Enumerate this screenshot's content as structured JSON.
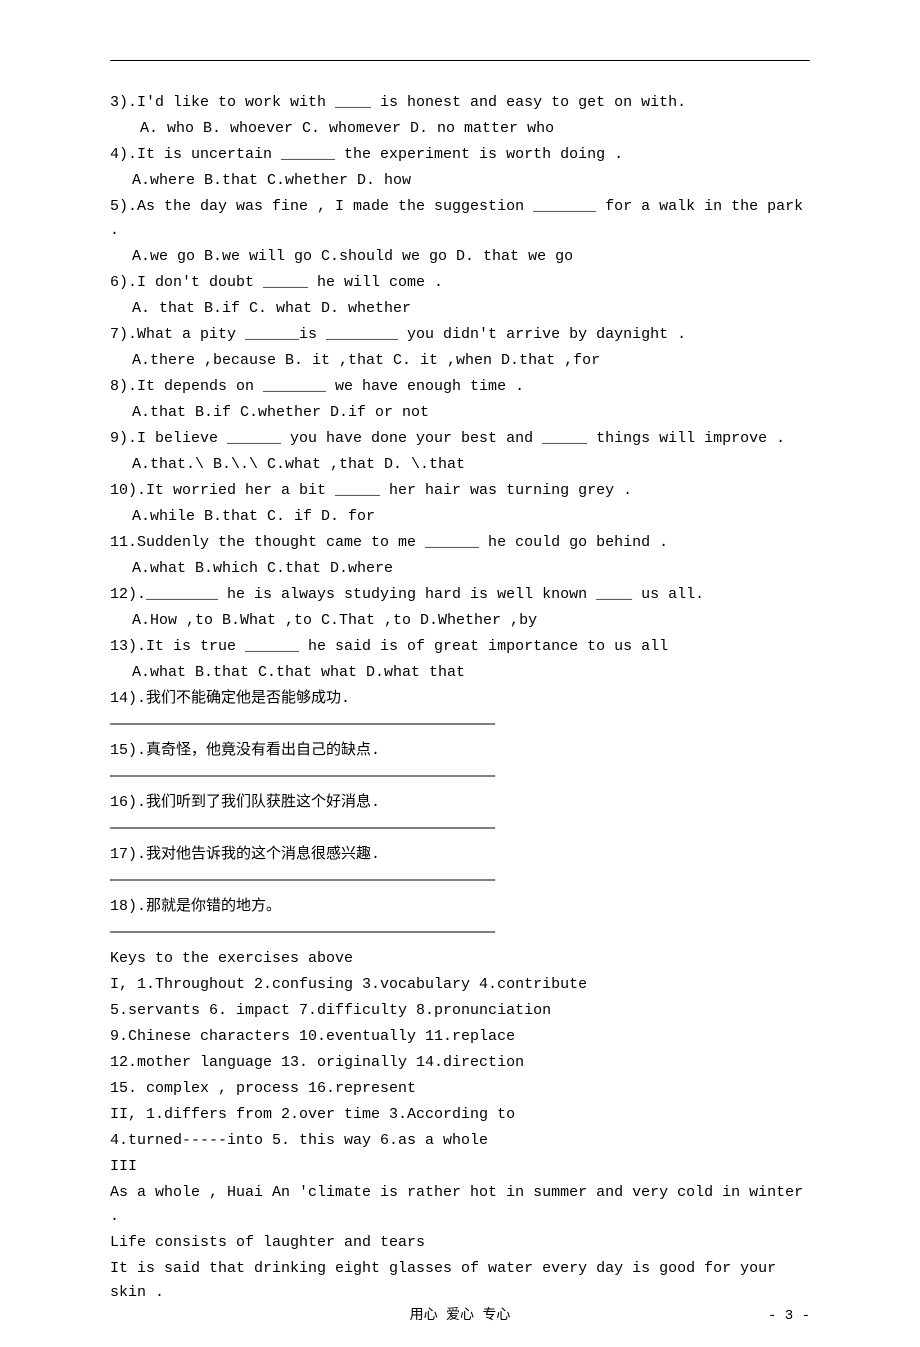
{
  "questions": {
    "q3": {
      "text": "3).I'd like to work with ____ is honest and easy to get on with.",
      "options": "A. who   B. whoever  C. whomever    D. no matter who"
    },
    "q4": {
      "text": "4).It is uncertain ______ the experiment is worth doing .",
      "options": "A.where  B.that  C.whether   D. how"
    },
    "q5": {
      "text": "5).As the day was fine , I made the suggestion _______ for  a walk in the park .",
      "options": "A.we go B.we will go  C.should we go  D. that we go"
    },
    "q6": {
      "text": "6).I don't doubt _____ he will come .",
      "options": "A. that  B.if  C. what  D. whether"
    },
    "q7": {
      "text": "7).What a pity ______is ________ you didn't arrive by daynight .",
      "options": "A.there ,because  B. it ,that  C. it ,when  D.that ,for"
    },
    "q8": {
      "text": "8).It depends on _______ we have enough time .",
      "options": "A.that  B.if   C.whether  D.if or not"
    },
    "q9": {
      "text": "9).I believe ______ you have done your best and _____ things will improve .",
      "options": "A.that.\\  B.\\.\\  C.what ,that   D. \\.that"
    },
    "q10": {
      "text": "10).It worried her a bit _____ her hair was turning grey .",
      "options": "A.while  B.that  C. if  D. for"
    },
    "q11": {
      "text": "11.Suddenly the thought came to me ______ he could go behind .",
      "options": "A.what  B.which  C.that  D.where"
    },
    "q12": {
      "text": "12).________ he is always studying hard is well known ____ us all.",
      "options": "A.How ,to  B.What ,to  C.That ,to  D.Whether ,by"
    },
    "q13": {
      "text": "13).It is true ______ he said is of great importance to us all",
      "options": "A.what  B.that  C.that what  D.what that"
    },
    "q14": "14).我们不能确定他是否能够成功.",
    "q15": "15).真奇怪，他竟没有看出自己的缺点.",
    "q16": "16).我们听到了我们队获胜这个好消息.",
    "q17": "17).我对他告诉我的这个消息很感兴趣.",
    "q18": "18).那就是你错的地方。"
  },
  "rule": "————————————————————————————————————————————————",
  "answers": {
    "header": "Keys to the exercises above",
    "I_line1": "I,   1.Throughout  2.confusing  3.vocabulary  4.contribute",
    "I_line2": "5.servants  6. impact  7.difficulty  8.pronunciation",
    "I_line3": "9.Chinese characters 10.eventually  11.replace",
    "I_line4": "12.mother language   13. originally 14.direction",
    "I_line5": "15. complex  , process  16.represent",
    "II_line1": "II,   1.differs from   2.over time  3.According to",
    "II_line2": " 4.turned-----into  5. this way  6.as a whole",
    "III_header": "III",
    "III_line1": "As a whole , Huai An 'climate is rather hot in summer and very cold in winter   .",
    "III_line2": "Life consists of laughter and tears",
    "III_line3": "It is said that drinking eight glasses of water every day  is good for your skin ."
  },
  "footer": {
    "center": "用心 爱心 专心",
    "page": "- 3 -"
  }
}
